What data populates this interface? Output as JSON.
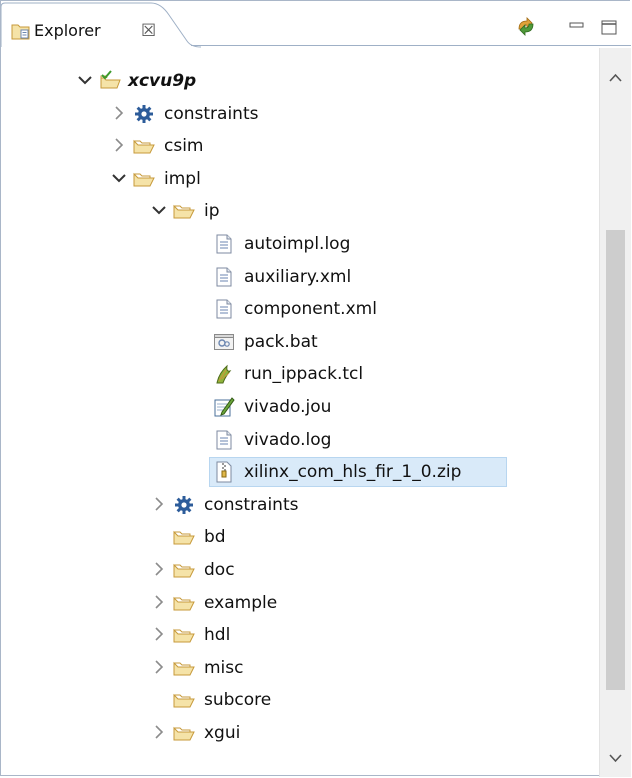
{
  "header": {
    "tab_title": "Explorer",
    "tab_close": "☒",
    "sync_button": "sync-icon",
    "minimize_button": "minimize-icon",
    "maximize_button": "maximize-icon"
  },
  "tree": {
    "project": {
      "label": "xcvu9p",
      "expanded": true
    },
    "items": [
      {
        "label": "constraints",
        "icon": "gear-icon",
        "expanded": false
      },
      {
        "label": "csim",
        "icon": "folder-icon",
        "expanded": false
      },
      {
        "label": "impl",
        "icon": "folder-icon",
        "expanded": true
      },
      {
        "label": "ip",
        "icon": "folder-icon",
        "expanded": true
      },
      {
        "label": "autoimpl.log",
        "icon": "text-file-icon"
      },
      {
        "label": "auxiliary.xml",
        "icon": "text-file-icon"
      },
      {
        "label": "component.xml",
        "icon": "text-file-icon"
      },
      {
        "label": "pack.bat",
        "icon": "batch-file-icon"
      },
      {
        "label": "run_ippack.tcl",
        "icon": "tcl-file-icon"
      },
      {
        "label": "vivado.jou",
        "icon": "journal-file-icon"
      },
      {
        "label": "vivado.log",
        "icon": "text-file-icon"
      },
      {
        "label": "xilinx_com_hls_fir_1_0.zip",
        "icon": "zip-file-icon",
        "selected": true
      },
      {
        "label": "constraints",
        "icon": "gear-icon",
        "expanded": false
      },
      {
        "label": "bd",
        "icon": "folder-icon"
      },
      {
        "label": "doc",
        "icon": "folder-icon",
        "expanded": false
      },
      {
        "label": "example",
        "icon": "folder-icon",
        "expanded": false
      },
      {
        "label": "hdl",
        "icon": "folder-icon",
        "expanded": false
      },
      {
        "label": "misc",
        "icon": "folder-icon",
        "expanded": false
      },
      {
        "label": "subcore",
        "icon": "folder-icon"
      },
      {
        "label": "xgui",
        "icon": "folder-icon",
        "expanded": false
      }
    ]
  },
  "colors": {
    "selection_bg": "#d9eaf9",
    "folder_fill": "#f5e3a8",
    "folder_stroke": "#c79a3a",
    "gear": "#2d5c9a"
  }
}
